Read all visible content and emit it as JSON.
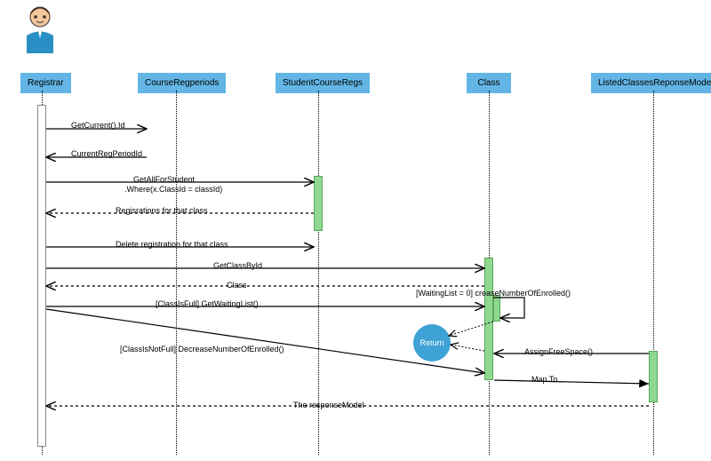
{
  "lifelines": {
    "a": "Registrar",
    "b": "CourseRegperiods",
    "c": "StudentCourseRegs",
    "d": "Class",
    "e": "ListedClassesReponseModel"
  },
  "messages": {
    "m1": "GetCurrent().Id",
    "m2": "CurrentRegPeriodId",
    "m3a": "GetAllForStudent",
    "m3b": ".Where(x.ClassId = classId)",
    "m4": "Regisrations for that class",
    "m5": "Delete registration for that class",
    "m6": "GetClassById",
    "m7": "Class",
    "m8": "[ClassIsFull] GetWaitingList()",
    "m9": "[WaitingList = 0]    creaseNumberOfEnrolled()",
    "m10": "AssignFreeSpace()",
    "m11": "[ClassIsNotFull] DecreaseNumberOfEnrolled()",
    "m12": "Map To",
    "m13": "The responseModel"
  },
  "badge": "Return"
}
